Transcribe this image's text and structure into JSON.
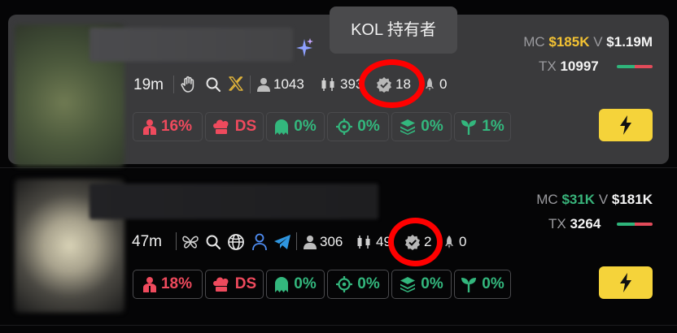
{
  "tooltip": {
    "text": "KOL 持有者"
  },
  "tokens": [
    {
      "age": "19m",
      "holders": "1043",
      "candles": "393",
      "kol": "18",
      "rocket": "0",
      "mc_label": "MC",
      "mc_value": "$185K",
      "vol_label": "V",
      "vol_value": "$1.19M",
      "tx_label": "TX",
      "tx_value": "10997",
      "chips": [
        "16%",
        "DS",
        "0%",
        "0%",
        "0%",
        "1%"
      ]
    },
    {
      "age": "47m",
      "holders": "306",
      "candles": "49",
      "kol": "2",
      "rocket": "0",
      "mc_label": "MC",
      "mc_value": "$31K",
      "vol_label": "V",
      "vol_value": "$181K",
      "tx_label": "TX",
      "tx_value": "3264",
      "chips": [
        "18%",
        "DS",
        "0%",
        "0%",
        "0%",
        "0%"
      ]
    }
  ],
  "colors": {
    "accent_yellow": "#f5d33a",
    "red": "#ef4a5d",
    "green": "#33b77d",
    "highlight_ring": "#ff0000"
  },
  "icons": [
    "hand-icon",
    "search-icon",
    "x-icon",
    "globe-icon",
    "person-icon",
    "telegram-icon",
    "holders-icon",
    "candles-icon",
    "verified-badge-icon",
    "rocket-icon",
    "person-red-icon",
    "chef-hat-icon",
    "ghost-icon",
    "crosshair-icon",
    "layers-icon",
    "sprout-icon",
    "bolt-icon",
    "sparkle-icon"
  ]
}
